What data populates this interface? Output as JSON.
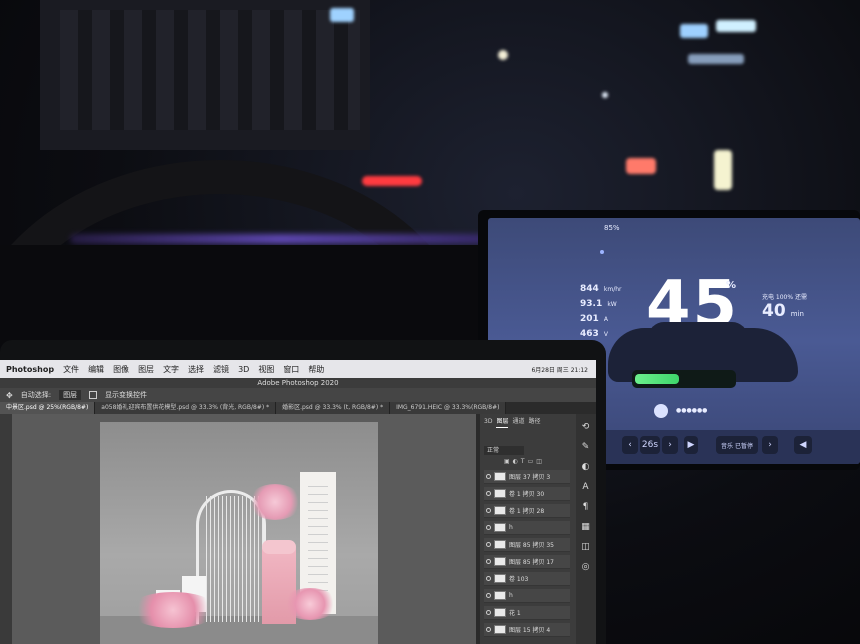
{
  "tesla": {
    "status_left": "85%",
    "stats": [
      {
        "value": "844",
        "unit": "km/hr"
      },
      {
        "value": "93.1",
        "unit": "kW"
      },
      {
        "value": "201",
        "unit": "A"
      },
      {
        "value": "463",
        "unit": "V"
      }
    ],
    "speed": "45",
    "speed_unit": "%",
    "right_label": "充电 100% 还需",
    "right_value": "40",
    "right_unit": "min",
    "media_back": "26s",
    "dock_label": "音乐 已暂停",
    "battery_fraction": 0.45
  },
  "photoshop": {
    "menu": [
      "Photoshop",
      "文件",
      "编辑",
      "图像",
      "图层",
      "文字",
      "选择",
      "滤镜",
      "3D",
      "视图",
      "窗口",
      "帮助"
    ],
    "clock": "6月28日 周三 21:12",
    "window_title": "Adobe Photoshop 2020",
    "options": [
      "自动选择:",
      "图层",
      "显示变换控件"
    ],
    "tabs": [
      {
        "label": "中景区.psd @ 25%(RGB/8#)",
        "active": true
      },
      {
        "label": "a058婚礼迎宾布置供花模型.psd @ 33.3% (背光, RGB/8#) *",
        "active": false
      },
      {
        "label": "婚影区.psd @ 33.3% (t, RGB/8#) *",
        "active": false
      },
      {
        "label": "IMG_6791.HEIC @ 33.3%(RGB/8#)",
        "active": false
      }
    ],
    "panel_tabs": [
      "3D",
      "图层",
      "通道",
      "路径"
    ],
    "blend_mode": "正常",
    "layers": [
      "图层 37 拷贝 3",
      "卷 1 拷贝 30",
      "卷 1 拷贝 28",
      "h",
      "图层 85 拷贝 35",
      "图层 85 拷贝 17",
      "卷 103",
      "h",
      "花 1",
      "图层 15 拷贝 4"
    ]
  }
}
